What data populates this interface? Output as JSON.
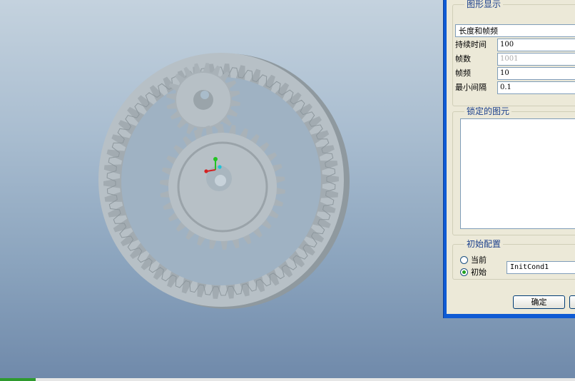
{
  "graphics_group": {
    "title": "图形显示",
    "mode_select": "长度和帧频",
    "rows": [
      {
        "label": "持续时间",
        "value": "100",
        "disabled": false
      },
      {
        "label": "帧数",
        "value": "1001",
        "disabled": true
      },
      {
        "label": "帧频",
        "value": "10",
        "disabled": false
      },
      {
        "label": "最小间隔",
        "value": "0.1",
        "disabled": false
      }
    ]
  },
  "locked_group": {
    "title": "锁定的图元"
  },
  "init_group": {
    "title": "初始配置",
    "option_current": "当前",
    "option_initial": "初始",
    "selected": "initial",
    "init_value": "InitCond1"
  },
  "buttons": {
    "ok": "确定"
  },
  "colors": {
    "dialog_face": "#ece9d8",
    "title_blue": "#0f5bd4",
    "group_title": "#1a3f8c",
    "gear": "#b7c0c6"
  }
}
